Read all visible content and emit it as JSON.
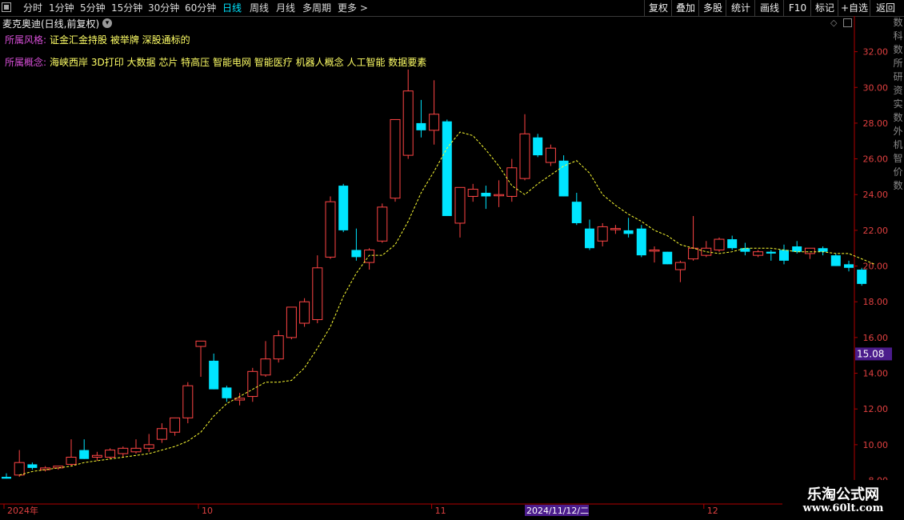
{
  "toolbar": {
    "timeframes": [
      "分时",
      "1分钟",
      "5分钟",
      "15分钟",
      "30分钟",
      "60分钟",
      "日线",
      "周线",
      "月线",
      "多周期",
      "更多 >"
    ],
    "active": "日线",
    "right_buttons": [
      "复权",
      "叠加",
      "多股",
      "统计",
      "画线",
      "F10",
      "标记",
      "+自选",
      "返回"
    ]
  },
  "header": {
    "title": "麦克奥迪(日线,前复权)",
    "style_label": "所属风格:",
    "style_value": "证金汇金持股 被举牌 深股通标的",
    "concept_label": "所属概念:",
    "concept_value": "海峡西岸 3D打印 大数据 芯片 特高压 智能电网 智能医疗 机器人概念 人工智能 数据要素"
  },
  "side_labels": [
    "数",
    "科",
    "数",
    "所",
    "研",
    "资",
    "实",
    "数",
    "外",
    "机",
    "智",
    "价",
    "数"
  ],
  "watermark": {
    "line1": "乐淘公式网",
    "line2": "www.60lt.com"
  },
  "chart_data": {
    "type": "candlestick",
    "ylim": [
      8,
      33
    ],
    "y_ticks": [
      "32.00",
      "30.00",
      "28.00",
      "26.00",
      "24.00",
      "22.00",
      "20.00",
      "18.00",
      "16.00",
      "14.00",
      "12.00",
      "10.00",
      "8.00"
    ],
    "price_label": "15.08",
    "x_labels": [
      {
        "index": 0,
        "text": "2024年"
      },
      {
        "index": 15,
        "text": "10"
      },
      {
        "index": 33,
        "text": "11"
      },
      {
        "index": 54,
        "text": "12"
      }
    ],
    "crosshair_date": "2024/11/12/二",
    "colors": {
      "up": "#ff4545",
      "down": "#00e5ff",
      "ma": "#ffff33",
      "axis": "#b00000"
    },
    "candles": [
      {
        "o": 8.2,
        "h": 8.4,
        "l": 8.1,
        "c": 8.1
      },
      {
        "o": 8.3,
        "h": 9.7,
        "l": 8.2,
        "c": 9.0
      },
      {
        "o": 8.9,
        "h": 9.0,
        "l": 8.6,
        "c": 8.7
      },
      {
        "o": 8.6,
        "h": 8.8,
        "l": 8.5,
        "c": 8.7
      },
      {
        "o": 8.7,
        "h": 8.8,
        "l": 8.6,
        "c": 8.8
      },
      {
        "o": 8.9,
        "h": 10.3,
        "l": 8.8,
        "c": 9.3
      },
      {
        "o": 9.7,
        "h": 10.3,
        "l": 9.2,
        "c": 9.2
      },
      {
        "o": 9.3,
        "h": 9.6,
        "l": 9.1,
        "c": 9.4
      },
      {
        "o": 9.3,
        "h": 9.8,
        "l": 9.2,
        "c": 9.7
      },
      {
        "o": 9.5,
        "h": 9.9,
        "l": 9.3,
        "c": 9.8
      },
      {
        "o": 9.6,
        "h": 10.3,
        "l": 9.5,
        "c": 9.8
      },
      {
        "o": 9.8,
        "h": 10.6,
        "l": 9.6,
        "c": 10.0
      },
      {
        "o": 10.3,
        "h": 11.2,
        "l": 10.1,
        "c": 10.9
      },
      {
        "o": 10.7,
        "h": 11.5,
        "l": 10.5,
        "c": 11.5
      },
      {
        "o": 11.5,
        "h": 13.5,
        "l": 11.2,
        "c": 13.3
      },
      {
        "o": 15.5,
        "h": 15.8,
        "l": 13.8,
        "c": 15.8
      },
      {
        "o": 14.7,
        "h": 15.1,
        "l": 13.1,
        "c": 13.1
      },
      {
        "o": 13.2,
        "h": 13.3,
        "l": 12.4,
        "c": 12.6
      },
      {
        "o": 12.5,
        "h": 12.9,
        "l": 12.2,
        "c": 12.6
      },
      {
        "o": 12.7,
        "h": 14.3,
        "l": 12.4,
        "c": 14.1
      },
      {
        "o": 13.9,
        "h": 15.8,
        "l": 13.8,
        "c": 14.8
      },
      {
        "o": 14.8,
        "h": 16.4,
        "l": 14.6,
        "c": 16.1
      },
      {
        "o": 16.0,
        "h": 17.7,
        "l": 15.9,
        "c": 17.7
      },
      {
        "o": 16.8,
        "h": 18.2,
        "l": 16.6,
        "c": 18.0
      },
      {
        "o": 17.0,
        "h": 20.6,
        "l": 16.8,
        "c": 19.9
      },
      {
        "o": 20.5,
        "h": 23.9,
        "l": 20.4,
        "c": 23.6
      },
      {
        "o": 24.5,
        "h": 24.6,
        "l": 21.9,
        "c": 22.0
      },
      {
        "o": 20.9,
        "h": 22.1,
        "l": 20.3,
        "c": 20.5
      },
      {
        "o": 20.2,
        "h": 21.0,
        "l": 19.8,
        "c": 20.9
      },
      {
        "o": 21.4,
        "h": 23.5,
        "l": 21.3,
        "c": 23.3
      },
      {
        "o": 23.8,
        "h": 28.2,
        "l": 23.6,
        "c": 28.2
      },
      {
        "o": 26.2,
        "h": 31.0,
        "l": 26.0,
        "c": 29.8
      },
      {
        "o": 28.0,
        "h": 29.3,
        "l": 27.2,
        "c": 27.6
      },
      {
        "o": 27.6,
        "h": 30.4,
        "l": 26.8,
        "c": 28.5
      },
      {
        "o": 28.1,
        "h": 28.2,
        "l": 22.8,
        "c": 22.8
      },
      {
        "o": 22.4,
        "h": 24.4,
        "l": 21.6,
        "c": 24.4
      },
      {
        "o": 23.9,
        "h": 24.6,
        "l": 23.6,
        "c": 24.3
      },
      {
        "o": 24.1,
        "h": 24.5,
        "l": 23.2,
        "c": 23.9
      },
      {
        "o": 24.0,
        "h": 24.8,
        "l": 23.3,
        "c": 24.0
      },
      {
        "o": 23.9,
        "h": 26.0,
        "l": 23.6,
        "c": 25.5
      },
      {
        "o": 24.9,
        "h": 28.5,
        "l": 24.8,
        "c": 27.4
      },
      {
        "o": 27.2,
        "h": 27.4,
        "l": 26.1,
        "c": 26.2
      },
      {
        "o": 25.8,
        "h": 26.8,
        "l": 25.6,
        "c": 26.6
      },
      {
        "o": 25.9,
        "h": 26.2,
        "l": 23.9,
        "c": 23.9
      },
      {
        "o": 23.6,
        "h": 24.1,
        "l": 22.3,
        "c": 22.4
      },
      {
        "o": 22.1,
        "h": 22.6,
        "l": 20.9,
        "c": 21.0
      },
      {
        "o": 21.4,
        "h": 22.4,
        "l": 21.1,
        "c": 22.2
      },
      {
        "o": 22.1,
        "h": 22.3,
        "l": 21.8,
        "c": 22.1
      },
      {
        "o": 22.0,
        "h": 22.7,
        "l": 21.6,
        "c": 21.8
      },
      {
        "o": 22.1,
        "h": 22.3,
        "l": 20.5,
        "c": 20.6
      },
      {
        "o": 20.9,
        "h": 21.1,
        "l": 20.2,
        "c": 20.9
      },
      {
        "o": 20.8,
        "h": 20.8,
        "l": 20.1,
        "c": 20.1
      },
      {
        "o": 19.8,
        "h": 20.3,
        "l": 19.1,
        "c": 20.2
      },
      {
        "o": 20.4,
        "h": 22.8,
        "l": 20.3,
        "c": 21.0
      },
      {
        "o": 20.6,
        "h": 21.4,
        "l": 20.5,
        "c": 21.0
      },
      {
        "o": 20.9,
        "h": 21.6,
        "l": 20.8,
        "c": 21.5
      },
      {
        "o": 21.5,
        "h": 21.7,
        "l": 20.9,
        "c": 21.0
      },
      {
        "o": 21.0,
        "h": 21.3,
        "l": 20.6,
        "c": 20.8
      },
      {
        "o": 20.6,
        "h": 20.9,
        "l": 20.5,
        "c": 20.8
      },
      {
        "o": 20.8,
        "h": 20.9,
        "l": 20.3,
        "c": 20.7
      },
      {
        "o": 20.9,
        "h": 21.2,
        "l": 20.1,
        "c": 20.3
      },
      {
        "o": 21.1,
        "h": 21.4,
        "l": 20.7,
        "c": 20.8
      },
      {
        "o": 20.7,
        "h": 21.0,
        "l": 20.4,
        "c": 21.0
      },
      {
        "o": 21.0,
        "h": 21.1,
        "l": 20.6,
        "c": 20.8
      },
      {
        "o": 20.6,
        "h": 20.7,
        "l": 20.0,
        "c": 20.0
      },
      {
        "o": 20.1,
        "h": 20.3,
        "l": 19.7,
        "c": 19.9
      },
      {
        "o": 19.8,
        "h": 19.9,
        "l": 18.9,
        "c": 19.0
      }
    ],
    "ma": [
      8.3,
      8.5,
      8.6,
      8.7,
      8.8,
      9.0,
      9.1,
      9.2,
      9.3,
      9.4,
      9.5,
      9.7,
      9.9,
      10.2,
      10.7,
      11.6,
      12.3,
      12.7,
      13.1,
      13.5,
      13.5,
      13.6,
      14.3,
      15.4,
      16.6,
      18.3,
      19.6,
      20.6,
      20.6,
      21.2,
      22.5,
      24.1,
      25.3,
      26.6,
      27.5,
      27.3,
      26.5,
      25.6,
      24.5,
      24.0,
      24.6,
      25.1,
      25.6,
      25.9,
      25.2,
      24.0,
      23.4,
      22.9,
      22.5,
      22.0,
      21.7,
      21.2,
      21.0,
      20.8,
      20.7,
      20.8,
      21.0,
      21.0,
      21.0,
      20.9,
      20.8,
      20.8,
      20.8,
      20.7,
      20.7,
      20.4,
      20.1
    ]
  }
}
